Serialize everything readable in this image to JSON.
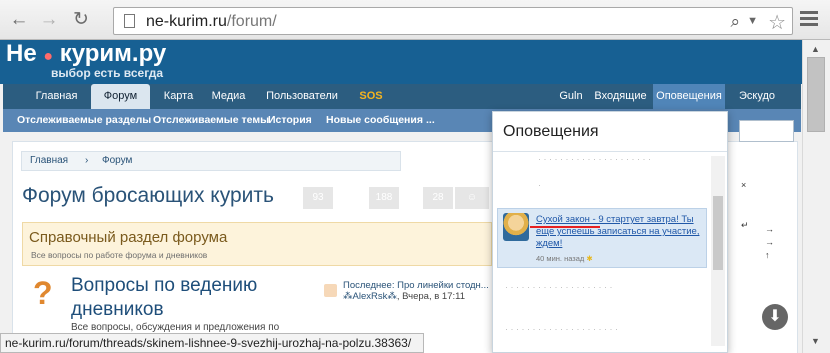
{
  "browser": {
    "url_host": "ne-kurim.ru",
    "url_path": "/forum/",
    "back_icon": "arrow-left-icon",
    "forward_icon": "arrow-right-icon",
    "reload_icon": "reload-icon"
  },
  "site": {
    "logo_text": "Не",
    "logo_text2": "курим.ру",
    "logo_sub": "выбор есть всегда",
    "nav": [
      "Главная",
      "Форум",
      "Карта",
      "Медиа",
      "Пользователи",
      "SOS",
      "Guln",
      "Входящие",
      "Оповещения",
      "Эскудо"
    ],
    "subnav": [
      "Отслеживаемые разделы",
      "Отслеживаемые темы",
      "История",
      "Новые сообщения",
      "..."
    ]
  },
  "content": {
    "breadcrumb": [
      "Главная",
      "Форум"
    ],
    "page_title": "Форум бросающих курить",
    "social_counts": [
      "93",
      "188",
      "28"
    ],
    "info_title": "Справочный раздел форума",
    "info_sub": "Все вопросы по работе форума и дневников",
    "node_title": "Вопросы по ведению дневников",
    "node_desc": "Все вопросы, обсуждения и предложения по",
    "last_label": "Последнее:",
    "last_link": "Про линейки стодн...",
    "last_author": "⁂AlexRsk⁂",
    "last_time": ", Вчера, в 17:11"
  },
  "popup": {
    "title": "Оповещения",
    "alert_text": "Сухой закон - 9 стартует завтра! Ты еще успеешь записаться на участие, ждем!",
    "alert_time": "40 мин. назад"
  },
  "status_url": "ne-kurim.ru/forum/threads/skinem-lishnee-9-svezhij-urozhaj-na-polzu.38363/"
}
